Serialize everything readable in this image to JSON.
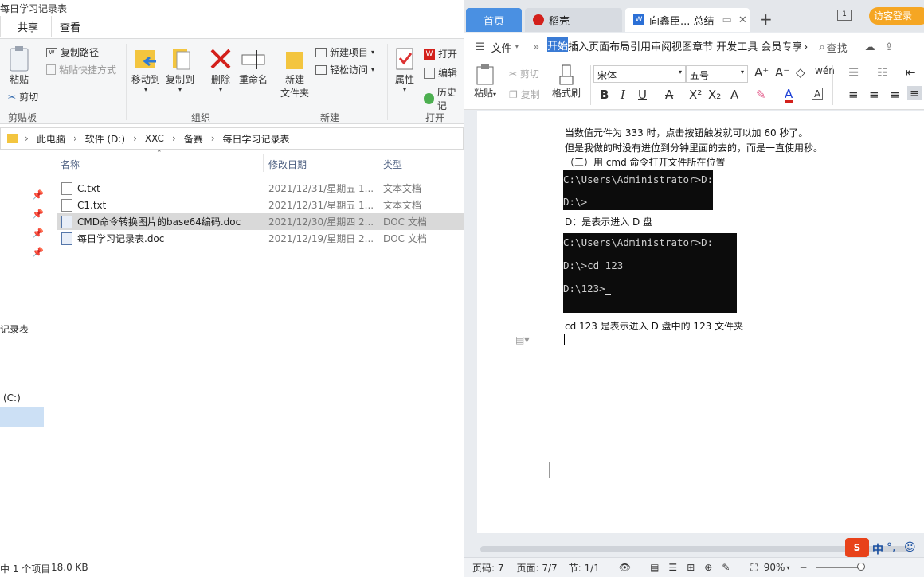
{
  "explorer": {
    "title": "每日学习记录表",
    "tabs": [
      "共享",
      "查看"
    ],
    "ribbon": {
      "clipboard": {
        "paste": "粘贴",
        "copy_path": "复制路径",
        "paste_shortcut": "粘贴快捷方式",
        "cut": "剪切",
        "label": "剪贴板"
      },
      "organize": {
        "move_to": "移动到",
        "copy_to": "复制到",
        "delete": "删除",
        "rename": "重命名",
        "label": "组织"
      },
      "new": {
        "new_folder_1": "新建",
        "new_folder_2": "文件夹",
        "new_item": "新建项目",
        "easy_access": "轻松访问",
        "label": "新建"
      },
      "open": {
        "properties": "属性",
        "open": "打开",
        "edit": "编辑",
        "history": "历史记",
        "label": "打开"
      }
    },
    "address": [
      "此电脑",
      "软件 (D:)",
      "XXC",
      "备赛",
      "每日学习记录表"
    ],
    "columns": {
      "name": "名称",
      "date": "修改日期",
      "type": "类型"
    },
    "files": [
      {
        "name": "C.txt",
        "date": "2021/12/31/星期五 1...",
        "type": "文本文档"
      },
      {
        "name": "C1.txt",
        "date": "2021/12/31/星期五 1...",
        "type": "文本文档"
      },
      {
        "name": "CMD命令转换图片的base64编码.doc",
        "date": "2021/12/30/星期四 2...",
        "type": "DOC 文档"
      },
      {
        "name": "每日学习记录表.doc",
        "date": "2021/12/19/星期日 2...",
        "type": "DOC 文档"
      }
    ],
    "nav": {
      "item1": "记录表",
      "drive": "(C:)"
    },
    "status": {
      "count": "中 1 个项目",
      "size": "18.0 KB"
    }
  },
  "wps": {
    "tabs": {
      "home": "首页",
      "daoke": "稻壳",
      "doc": "向鑫臣... 总结",
      "plus": "+"
    },
    "login": "访客登录",
    "menu": {
      "file": "文件",
      "items": "开始插入页面布局引用审阅视图章节 开发工具 会员专享稻壳",
      "start": "开始",
      "search": "查找"
    },
    "toolbar": {
      "paste": "粘贴",
      "cut": "剪切",
      "copy": "复制",
      "format_painter": "格式刷",
      "font": "宋体",
      "size": "五号"
    },
    "doc": {
      "line1": "当数值元件为 333 时，点击按钮触发就可以加 60 秒了。",
      "line2": "但是我做的时没有进位到分钟里面的去的，而是一直使用秒。",
      "line3": "（三）用 cmd 命令打开文件所在位置",
      "cmd1": [
        "C:\\Users\\Administrator>D:",
        "D:\\>"
      ],
      "note1": "D：是表示进入 D 盘",
      "cmd2": [
        "C:\\Users\\Administrator>D:",
        "D:\\>cd 123",
        "D:\\123>"
      ],
      "note2": "cd 123 是表示进入 D 盘中的 123 文件夹"
    },
    "status": {
      "page": "页码: 7",
      "pages": "页面: 7/7",
      "section": "节: 1/1",
      "zoom": "90%"
    },
    "ime": "中"
  }
}
